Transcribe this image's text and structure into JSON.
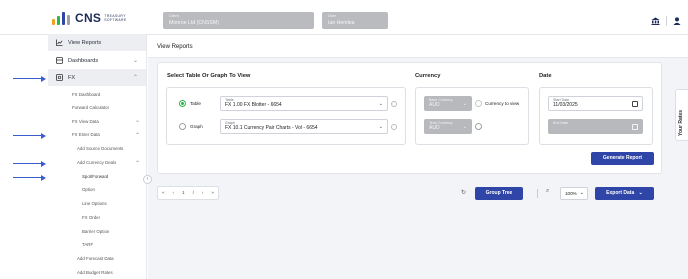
{
  "brand": {
    "name": "CNS",
    "tagline_1": "TREASURY",
    "tagline_2": "SOFTWARE",
    "colors": [
      "#f0a020",
      "#2f46a8",
      "#2db34a",
      "#9aa0a6"
    ]
  },
  "header": {
    "client_caption": "Client",
    "client_value": "Monroe Ltd (CNSSM)",
    "user_caption": "User",
    "user_value": "Ian Hemlea",
    "icons": [
      "shield-icon",
      "user-icon"
    ]
  },
  "sidebar": {
    "items": [
      {
        "label": "View Reports",
        "icon": "chart-icon"
      },
      {
        "label": "Dashboards",
        "icon": "dashboard-icon"
      },
      {
        "label": "FX",
        "icon": "fx-icon"
      }
    ],
    "sub_items": [
      {
        "label": "FX Dashboard"
      },
      {
        "label": "Forward Calculator"
      },
      {
        "label": "FX View Data"
      },
      {
        "label": "FX Enter Data"
      },
      {
        "label": "Add Source Documents"
      },
      {
        "label": "Add Currency Deals"
      },
      {
        "label": "Spot/Forward"
      },
      {
        "label": "Option"
      },
      {
        "label": "Line Options"
      },
      {
        "label": "FX Order"
      },
      {
        "label": "Barrier Option"
      },
      {
        "label": "TARF"
      },
      {
        "label": "Add Forecast Data"
      },
      {
        "label": "Add Budget Rates"
      }
    ]
  },
  "main": {
    "title": "View Reports",
    "select_section_title": "Select Table Or Graph To View",
    "currency_section_title": "Currency",
    "date_section_title": "Date",
    "table_radio_label": "Table",
    "graph_radio_label": "Graph",
    "table_select": {
      "caption": "Table",
      "value": "FX 1.00 FX Blotter - 6654"
    },
    "graph_select": {
      "caption": "Graph",
      "value": "FX 10.1 Currency Pair Charts - Vol - 6654"
    },
    "base_currency": {
      "caption": "Base Currency",
      "value": "AUD"
    },
    "currency_to_view_label": "Currency to view",
    "term_currency": {
      "caption": "Term Currency",
      "value": "AUD"
    },
    "start_date": {
      "caption": "Start Date",
      "value": "11/03/2025"
    },
    "end_date": {
      "caption": "End Date",
      "value": ""
    },
    "generate_button": "Generate Report",
    "group_tree_button": "Group Tree",
    "export_button": "Export Data",
    "zoom_value": "100%",
    "pager": {
      "current": "1",
      "separator": "/"
    },
    "rates_tab": "Your Rates",
    "accent_color": "#2f46a8",
    "radio_color": "#2db34a"
  }
}
